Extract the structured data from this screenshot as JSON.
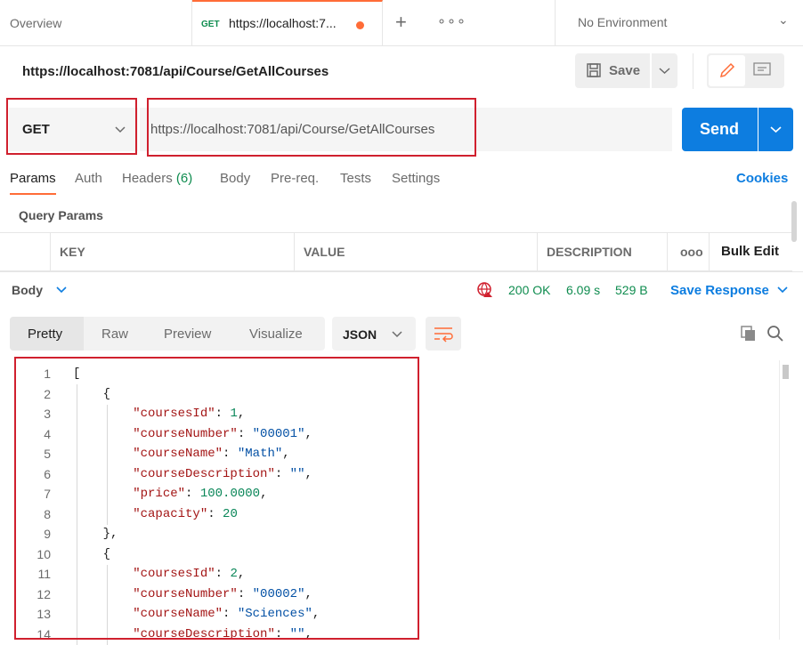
{
  "tabs": {
    "overview": "Overview",
    "active": {
      "method": "GET",
      "url": "https://localhost:7..."
    },
    "environment": "No Environment"
  },
  "request": {
    "title": "https://localhost:7081/api/Course/GetAllCourses",
    "save_label": "Save",
    "method": "GET",
    "url": "https://localhost:7081/api/Course/GetAllCourses",
    "send_label": "Send"
  },
  "request_tabs": [
    {
      "label": "Params"
    },
    {
      "label": "Auth"
    },
    {
      "label": "Headers",
      "count": "(6)"
    },
    {
      "label": "Body"
    },
    {
      "label": "Pre-req."
    },
    {
      "label": "Tests"
    },
    {
      "label": "Settings"
    }
  ],
  "cookies_label": "Cookies",
  "query_params_label": "Query Params",
  "params_table": {
    "headers": [
      "KEY",
      "VALUE",
      "DESCRIPTION"
    ],
    "more": "ooo",
    "bulk_edit": "Bulk Edit"
  },
  "response": {
    "body_label": "Body",
    "status": "200 OK",
    "time": "6.09 s",
    "size": "529 B",
    "save_response": "Save Response"
  },
  "format": {
    "modes": [
      "Pretty",
      "Raw",
      "Preview",
      "Visualize"
    ],
    "language": "JSON"
  },
  "code_lines": [
    {
      "n": "1",
      "parts": [
        [
          "p",
          "["
        ]
      ]
    },
    {
      "n": "2",
      "parts": [
        [
          "p",
          "    {"
        ]
      ]
    },
    {
      "n": "3",
      "parts": [
        [
          "p",
          "        "
        ],
        [
          "k",
          "\"coursesId\""
        ],
        [
          "p",
          ": "
        ],
        [
          "n",
          "1"
        ],
        [
          "p",
          ","
        ]
      ]
    },
    {
      "n": "4",
      "parts": [
        [
          "p",
          "        "
        ],
        [
          "k",
          "\"courseNumber\""
        ],
        [
          "p",
          ": "
        ],
        [
          "s",
          "\"00001\""
        ],
        [
          "p",
          ","
        ]
      ]
    },
    {
      "n": "5",
      "parts": [
        [
          "p",
          "        "
        ],
        [
          "k",
          "\"courseName\""
        ],
        [
          "p",
          ": "
        ],
        [
          "s",
          "\"Math\""
        ],
        [
          "p",
          ","
        ]
      ]
    },
    {
      "n": "6",
      "parts": [
        [
          "p",
          "        "
        ],
        [
          "k",
          "\"courseDescription\""
        ],
        [
          "p",
          ": "
        ],
        [
          "s",
          "\"\""
        ],
        [
          "p",
          ","
        ]
      ]
    },
    {
      "n": "7",
      "parts": [
        [
          "p",
          "        "
        ],
        [
          "k",
          "\"price\""
        ],
        [
          "p",
          ": "
        ],
        [
          "n",
          "100.0000"
        ],
        [
          "p",
          ","
        ]
      ]
    },
    {
      "n": "8",
      "parts": [
        [
          "p",
          "        "
        ],
        [
          "k",
          "\"capacity\""
        ],
        [
          "p",
          ": "
        ],
        [
          "n",
          "20"
        ]
      ]
    },
    {
      "n": "9",
      "parts": [
        [
          "p",
          "    },"
        ]
      ]
    },
    {
      "n": "10",
      "parts": [
        [
          "p",
          "    {"
        ]
      ]
    },
    {
      "n": "11",
      "parts": [
        [
          "p",
          "        "
        ],
        [
          "k",
          "\"coursesId\""
        ],
        [
          "p",
          ": "
        ],
        [
          "n",
          "2"
        ],
        [
          "p",
          ","
        ]
      ]
    },
    {
      "n": "12",
      "parts": [
        [
          "p",
          "        "
        ],
        [
          "k",
          "\"courseNumber\""
        ],
        [
          "p",
          ": "
        ],
        [
          "s",
          "\"00002\""
        ],
        [
          "p",
          ","
        ]
      ]
    },
    {
      "n": "13",
      "parts": [
        [
          "p",
          "        "
        ],
        [
          "k",
          "\"courseName\""
        ],
        [
          "p",
          ": "
        ],
        [
          "s",
          "\"Sciences\""
        ],
        [
          "p",
          ","
        ]
      ]
    },
    {
      "n": "14",
      "parts": [
        [
          "p",
          "        "
        ],
        [
          "k",
          "\"courseDescription\""
        ],
        [
          "p",
          ": "
        ],
        [
          "s",
          "\"\""
        ],
        [
          "p",
          ","
        ]
      ]
    }
  ],
  "colors": {
    "accent": "#ff6c37",
    "send": "#0d7de0",
    "success": "#0f8c4f",
    "highlight": "#d0202e"
  }
}
